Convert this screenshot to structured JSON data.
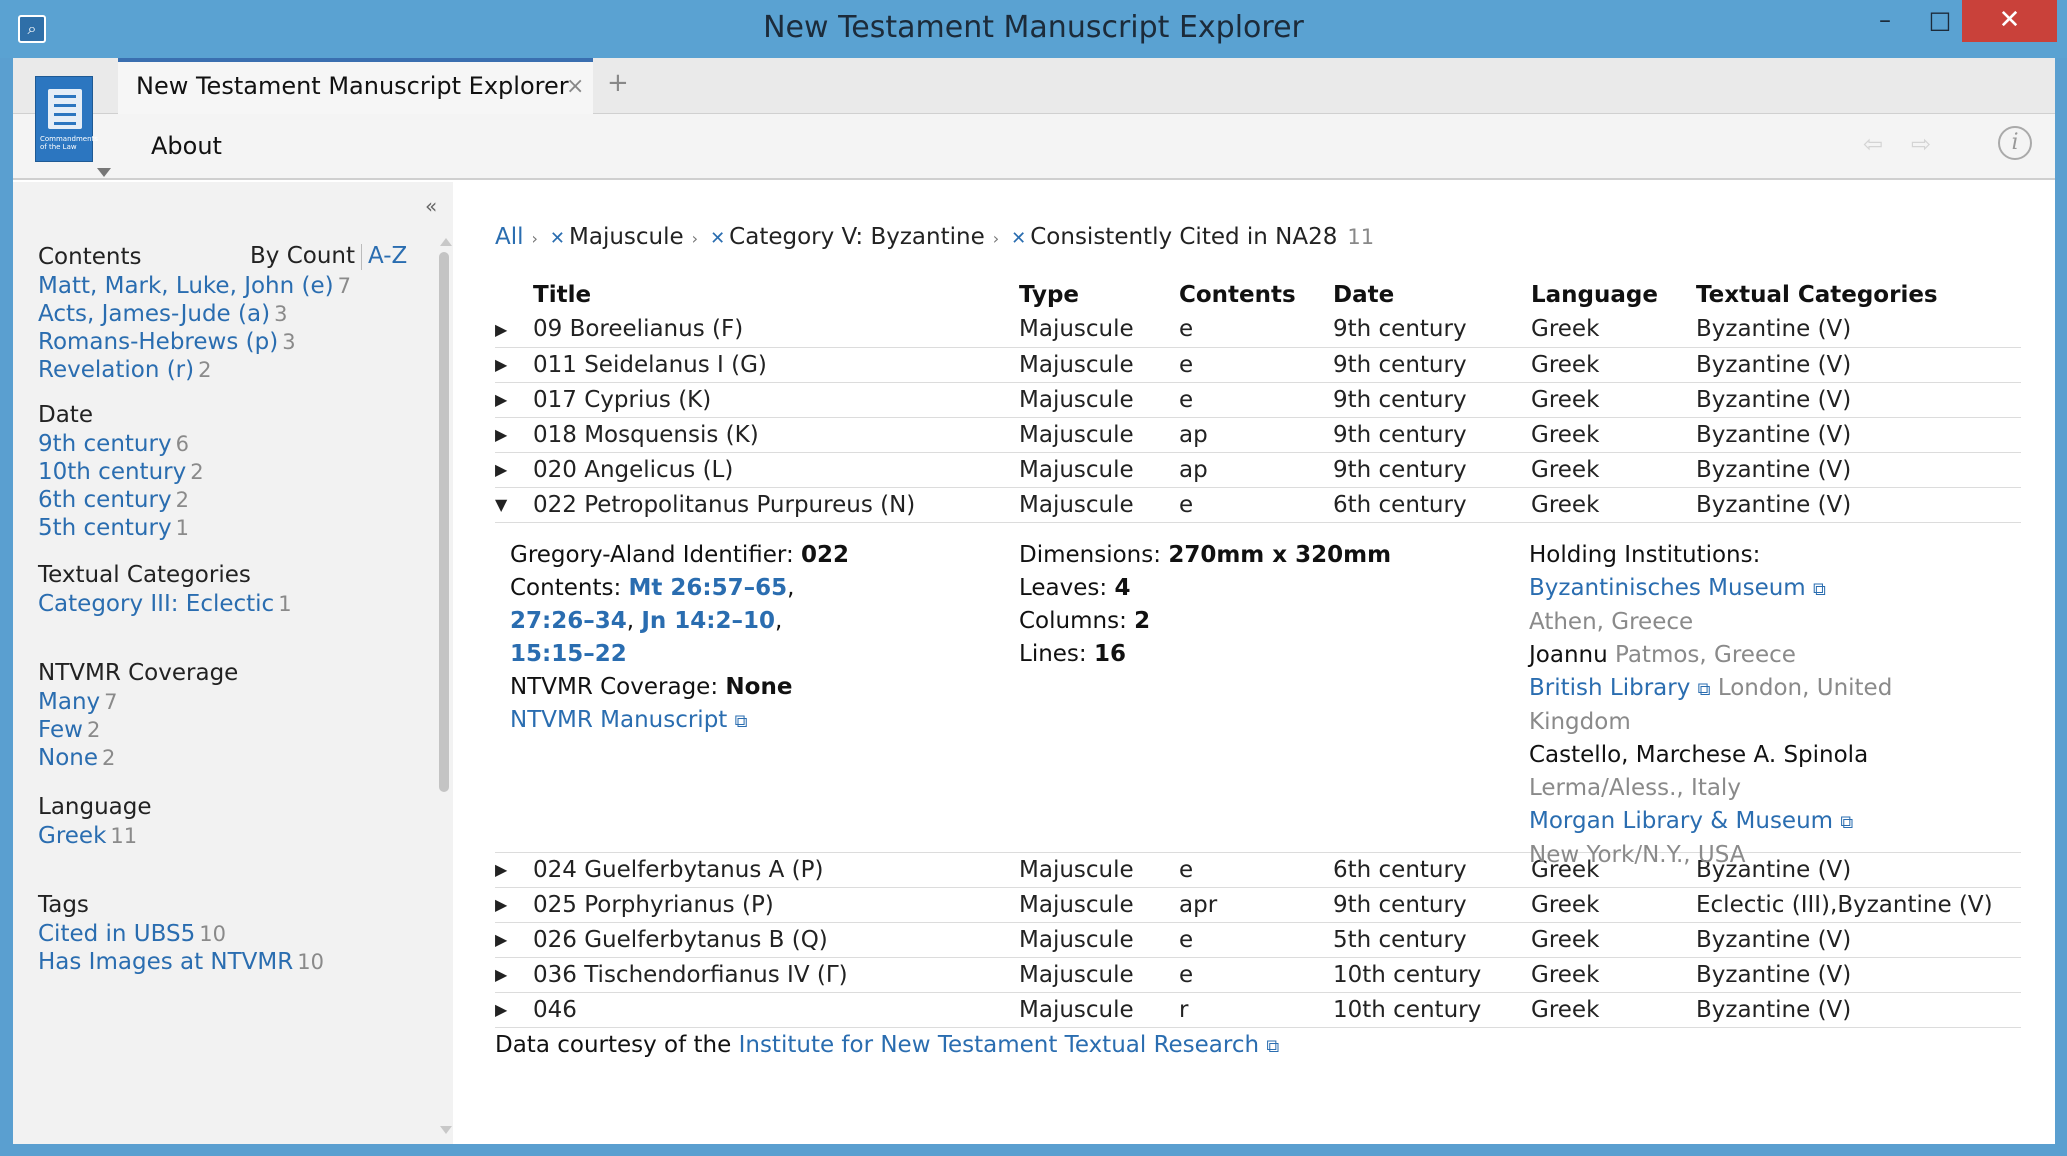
{
  "window": {
    "title": "New Testament Manuscript Explorer",
    "minimize": "–",
    "maximize": "□",
    "close": "✕"
  },
  "tab": {
    "label": "New Testament Manuscript Explorer",
    "close": "×",
    "add": "+"
  },
  "menu": {
    "about": "About"
  },
  "logo": {
    "caption": "Commandments of the Law"
  },
  "sidebar": {
    "collapse": "«",
    "sort_by_count": "By Count",
    "sort_az": "A-Z",
    "facets": [
      {
        "heading": "Contents",
        "items": [
          {
            "label": "Matt, Mark, Luke, John (e)",
            "count": "7"
          },
          {
            "label": "Acts, James-Jude (a)",
            "count": "3"
          },
          {
            "label": "Romans-Hebrews (p)",
            "count": "3"
          },
          {
            "label": "Revelation (r)",
            "count": "2"
          }
        ]
      },
      {
        "heading": "Date",
        "items": [
          {
            "label": "9th century",
            "count": "6"
          },
          {
            "label": "10th century",
            "count": "2"
          },
          {
            "label": "6th century",
            "count": "2"
          },
          {
            "label": "5th century",
            "count": "1"
          }
        ]
      },
      {
        "heading": "Textual Categories",
        "items": [
          {
            "label": "Category III: Eclectic",
            "count": "1"
          }
        ]
      },
      {
        "heading": "NTVMR Coverage",
        "items": [
          {
            "label": "Many",
            "count": "7"
          },
          {
            "label": "Few",
            "count": "2"
          },
          {
            "label": "None",
            "count": "2"
          }
        ]
      },
      {
        "heading": "Language",
        "items": [
          {
            "label": "Greek",
            "count": "11"
          }
        ]
      },
      {
        "heading": "Tags",
        "items": [
          {
            "label": "Cited in UBS5",
            "count": "10"
          },
          {
            "label": "Has Images at NTVMR",
            "count": "10"
          }
        ]
      }
    ]
  },
  "breadcrumb": {
    "all": "All",
    "filters": [
      "Majuscule",
      "Category V: Byzantine",
      "Consistently Cited in NA28"
    ],
    "total": "11"
  },
  "table": {
    "headers": [
      "Title",
      "Type",
      "Contents",
      "Date",
      "Language",
      "Textual Categories"
    ],
    "rows_before": [
      [
        "09 Boreelianus (F)",
        "Majuscule",
        "e",
        "9th century",
        "Greek",
        "Byzantine (V)"
      ],
      [
        "011 Seidelanus I (G)",
        "Majuscule",
        "e",
        "9th century",
        "Greek",
        "Byzantine (V)"
      ],
      [
        "017 Cyprius (K)",
        "Majuscule",
        "e",
        "9th century",
        "Greek",
        "Byzantine (V)"
      ],
      [
        "018 Mosquensis (K)",
        "Majuscule",
        "ap",
        "9th century",
        "Greek",
        "Byzantine (V)"
      ],
      [
        "020 Angelicus (L)",
        "Majuscule",
        "ap",
        "9th century",
        "Greek",
        "Byzantine (V)"
      ]
    ],
    "expanded_row": [
      "022 Petropolitanus Purpureus (N)",
      "Majuscule",
      "e",
      "6th century",
      "Greek",
      "Byzantine (V)"
    ],
    "rows_after": [
      [
        "024 Guelferbytanus A (P)",
        "Majuscule",
        "e",
        "6th century",
        "Greek",
        "Byzantine (V)"
      ],
      [
        "025 Porphyrianus (P)",
        "Majuscule",
        "apr",
        "9th century",
        "Greek",
        "Eclectic (III),Byzantine (V)"
      ],
      [
        "026 Guelferbytanus B (Q)",
        "Majuscule",
        "e",
        "5th century",
        "Greek",
        "Byzantine (V)"
      ],
      [
        "036 Tischendorfianus IV (Γ)",
        "Majuscule",
        "e",
        "10th century",
        "Greek",
        "Byzantine (V)"
      ],
      [
        "046",
        "Majuscule",
        "r",
        "10th century",
        "Greek",
        "Byzantine (V)"
      ]
    ],
    "collapsed_marker": "▶",
    "expanded_marker": "▼"
  },
  "detail": {
    "ga_label": "Gregory-Aland Identifier:",
    "ga_value": "022",
    "contents_label": "Contents:",
    "contents_refs": [
      "Mt 26:57–65",
      "27:26–34",
      "Jn 14:2–10",
      "15:15–22"
    ],
    "coverage_label": "NTVMR Coverage:",
    "coverage_value": "None",
    "ntvmr_link": "NTVMR Manuscript",
    "dimensions_label": "Dimensions:",
    "dimensions_value": "270mm x 320mm",
    "leaves_label": "Leaves:",
    "leaves_value": "4",
    "columns_label": "Columns:",
    "columns_value": "2",
    "lines_label": "Lines:",
    "lines_value": "16",
    "holding_label": "Holding Institutions:",
    "institutions": [
      {
        "name": "Byzantinisches Museum",
        "link": true,
        "place": "Athen, Greece"
      },
      {
        "name": "Joannu",
        "link": false,
        "place": "Patmos, Greece"
      },
      {
        "name": "British Library",
        "link": true,
        "place": "London, United Kingdom"
      },
      {
        "name": "Castello, Marchese A. Spinola",
        "link": false,
        "place": "Lerma/Aless., Italy"
      },
      {
        "name": "Morgan Library & Museum",
        "link": true,
        "place": "New York/N.Y., USA"
      }
    ]
  },
  "footer": {
    "prefix": "Data courtesy of the",
    "link": "Institute for New Testament Textual Research"
  },
  "icons": {
    "external": "⧉",
    "back": "⇦",
    "forward": "⇨",
    "info": "i"
  }
}
